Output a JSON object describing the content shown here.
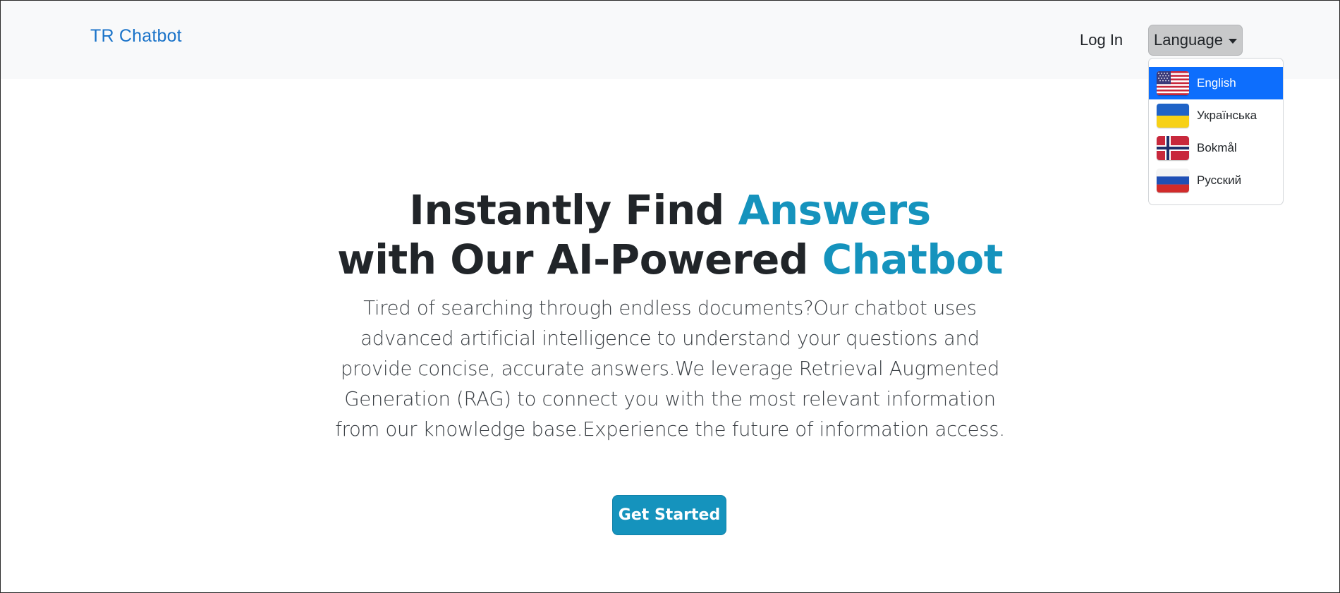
{
  "navbar": {
    "brand": "TR Chatbot",
    "login_label": "Log In",
    "language_button_label": "Language"
  },
  "language_menu": {
    "items": [
      {
        "label": "English",
        "flag": "us-flag-icon",
        "selected": true
      },
      {
        "label": "Українська",
        "flag": "ukraine-flag-icon",
        "selected": false
      },
      {
        "label": "Bokmål",
        "flag": "norway-flag-icon",
        "selected": false
      },
      {
        "label": "Русский",
        "flag": "russia-flag-icon",
        "selected": false
      }
    ]
  },
  "hero": {
    "title_line1_part1": "Instantly Find ",
    "title_line1_accent": "Answers",
    "title_line2_part1": "with Our AI-Powered ",
    "title_line2_accent": "Chatbot",
    "description": "Tired of searching through endless documents?Our chatbot uses advanced artificial intelligence to understand your questions and provide concise, accurate answers.We leverage Retrieval Augmented Generation (RAG) to connect you with the most relevant information from our knowledge base.Experience the future of information access.",
    "cta_label": "Get Started"
  },
  "colors": {
    "navbar_bg": "#f8f9fa",
    "brand": "#1a73c9",
    "accent": "#1593bd",
    "active_item": "#0d6efd"
  }
}
